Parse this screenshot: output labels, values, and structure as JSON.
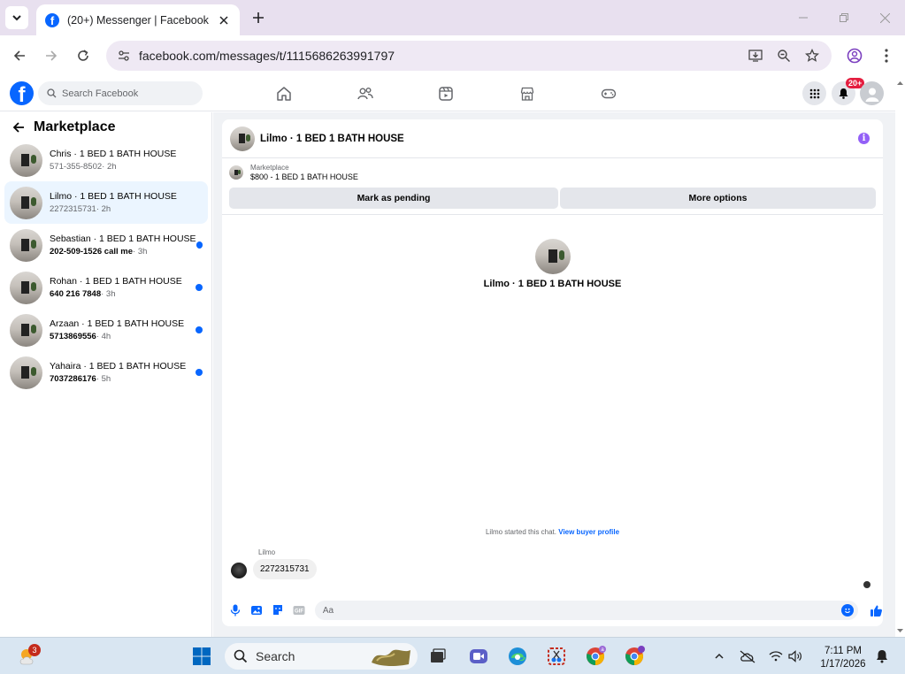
{
  "browser": {
    "tab_title": "(20+) Messenger | Facebook",
    "url": "facebook.com/messages/t/1115686263991797"
  },
  "facebook": {
    "search_placeholder": "Search Facebook",
    "notifications_badge": "20+"
  },
  "sidebar": {
    "title": "Marketplace",
    "conversations": [
      {
        "name": "Chris · 1 BED 1 BATH HOUSE",
        "preview": "571-355-8502",
        "ago": "· 2h",
        "unread": false,
        "active": false
      },
      {
        "name": "Lilmo · 1 BED 1 BATH HOUSE",
        "preview": "2272315731",
        "ago": "· 2h",
        "unread": false,
        "active": true
      },
      {
        "name": "Sebastian · 1 BED 1 BATH HOUSE",
        "preview": "202-509-1526 call me",
        "ago": "· 3h",
        "unread": true,
        "active": false
      },
      {
        "name": "Rohan · 1 BED 1 BATH HOUSE",
        "preview": "640 216 7848",
        "ago": "· 3h",
        "unread": true,
        "active": false
      },
      {
        "name": "Arzaan · 1 BED 1 BATH HOUSE",
        "preview": "5713869556",
        "ago": "· 4h",
        "unread": true,
        "active": false
      },
      {
        "name": "Yahaira · 1 BED 1 BATH HOUSE",
        "preview": "7037286176",
        "ago": "· 5h",
        "unread": true,
        "active": false
      }
    ]
  },
  "chat": {
    "header_title": "Lilmo · 1 BED 1 BATH HOUSE",
    "listing_category": "Marketplace",
    "listing_price_title": "$800 - 1 BED 1 BATH HOUSE",
    "mark_pending_label": "Mark as pending",
    "more_options_label": "More options",
    "center_name": "Lilmo · 1 BED 1 BATH HOUSE",
    "started_text": "Lilmo started this chat.",
    "view_profile_link": "View buyer profile",
    "sender_name": "Lilmo",
    "message_text": "2272315731",
    "composer_placeholder": "Aa"
  },
  "taskbar": {
    "search_label": "Search",
    "weather_badge": "3",
    "time": "7:11 PM",
    "date": "1/17/2026"
  },
  "colors": {
    "facebook_blue": "#0866ff",
    "unread_dot": "#0866ff",
    "active_row": "#ebf5ff",
    "info_purple": "#9360f7"
  }
}
